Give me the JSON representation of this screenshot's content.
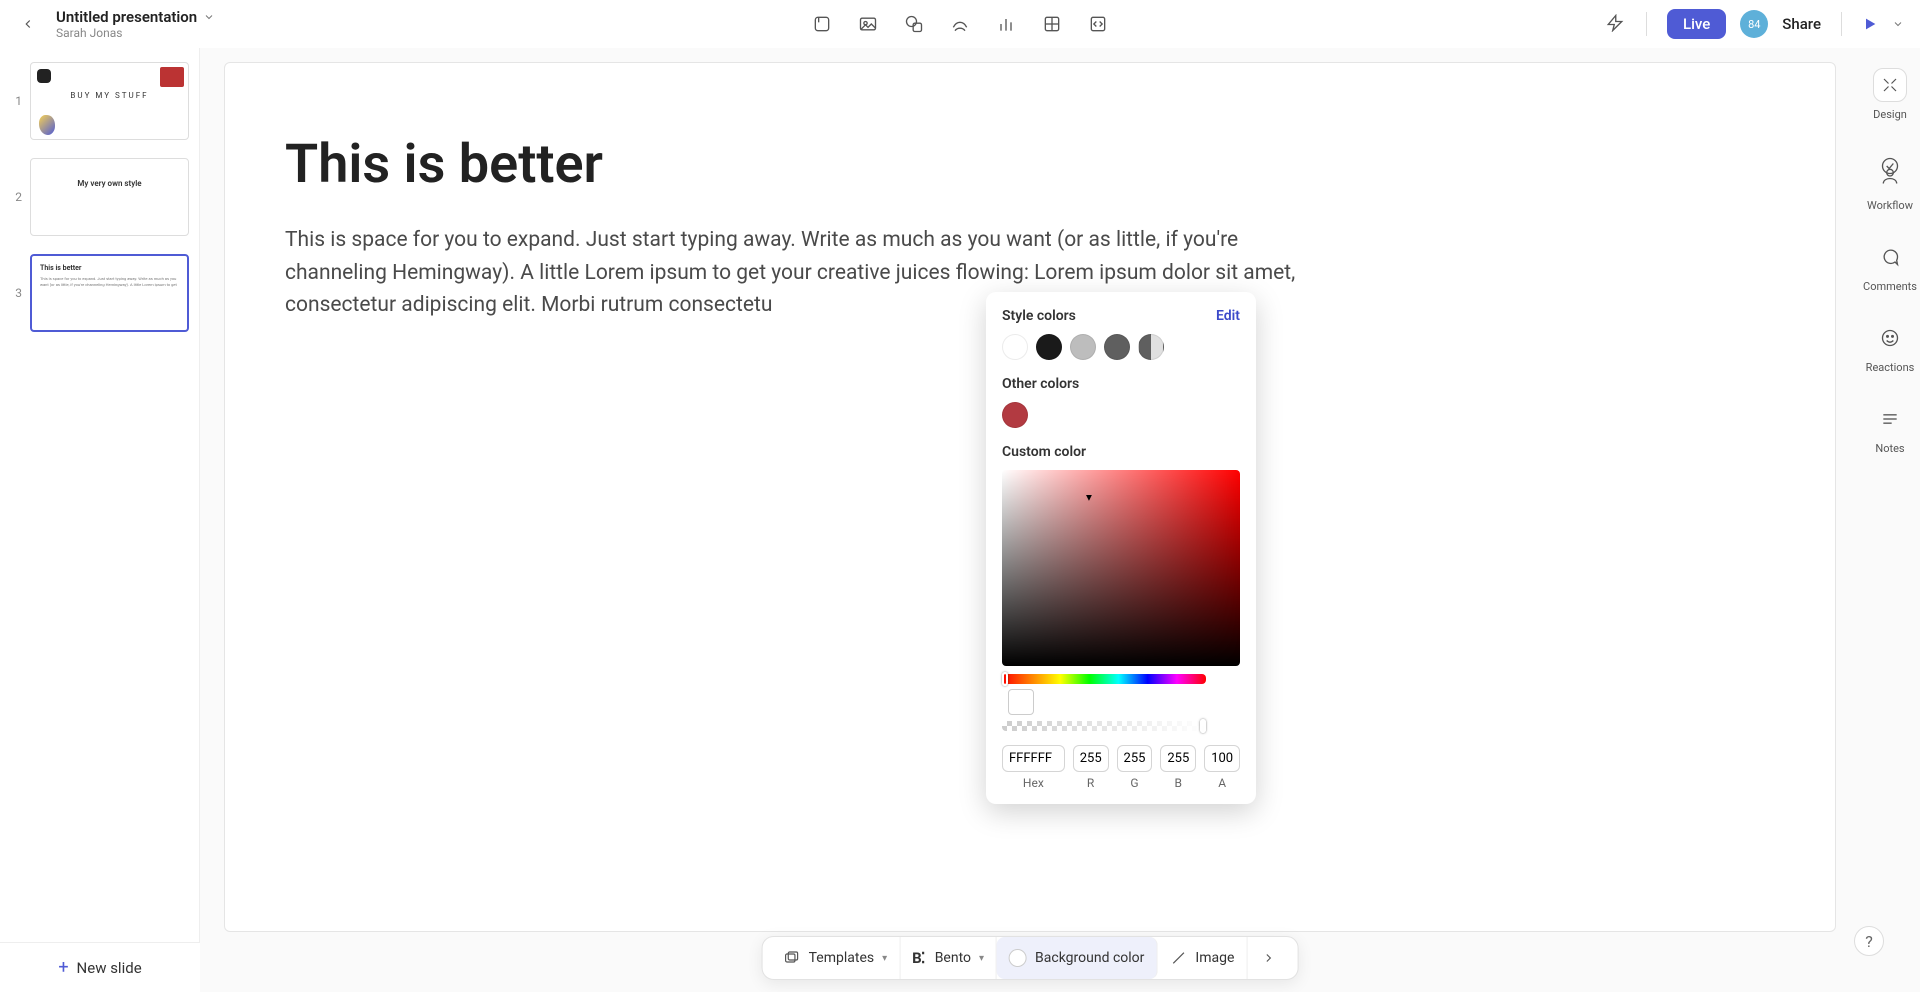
{
  "header": {
    "presentation_title": "Untitled presentation",
    "author": "Sarah Jonas",
    "live_label": "Live",
    "avatar_initials": "84",
    "share_label": "Share"
  },
  "insert_tools": [
    "template-icon",
    "image-icon",
    "shape-icon",
    "draw-icon",
    "chart-icon",
    "table-icon",
    "embed-icon"
  ],
  "right_rail": {
    "design": "Design",
    "workflow": "Workflow",
    "comments": "Comments",
    "reactions": "Reactions",
    "notes": "Notes"
  },
  "thumbnails": [
    {
      "n": "1",
      "title": "BUY MY STUFF"
    },
    {
      "n": "2",
      "title": "My very own style"
    },
    {
      "n": "3",
      "title": "This is better",
      "body": "This is space for you to expand. Just start typing away. Write as much as you want (or as little, if you're channeling Hemingway). A little Lorem ipsum to get"
    }
  ],
  "active_thumb_index": 2,
  "new_slide_label": "New slide",
  "slide": {
    "title": "This is better",
    "body": "This is space for you to expand. Just start typing away. Write as much as you want (or as little, if you're channeling Hemingway). A little Lorem ipsum to get your creative juices flowing: Lorem ipsum dolor sit amet, consectetur adipiscing elit. Morbi rutrum consectetu"
  },
  "color_picker": {
    "style_colors_label": "Style colors",
    "edit_label": "Edit",
    "other_colors_label": "Other colors",
    "custom_color_label": "Custom color",
    "hex": "FFFFFF",
    "r": "255",
    "g": "255",
    "b": "255",
    "a": "100",
    "hex_label": "Hex",
    "r_label": "R",
    "g_label": "G",
    "b_label": "B",
    "a_label": "A"
  },
  "bottom_toolbar": {
    "templates": "Templates",
    "bento": "Bento",
    "background_color": "Background color",
    "image": "Image"
  },
  "help_label": "?"
}
